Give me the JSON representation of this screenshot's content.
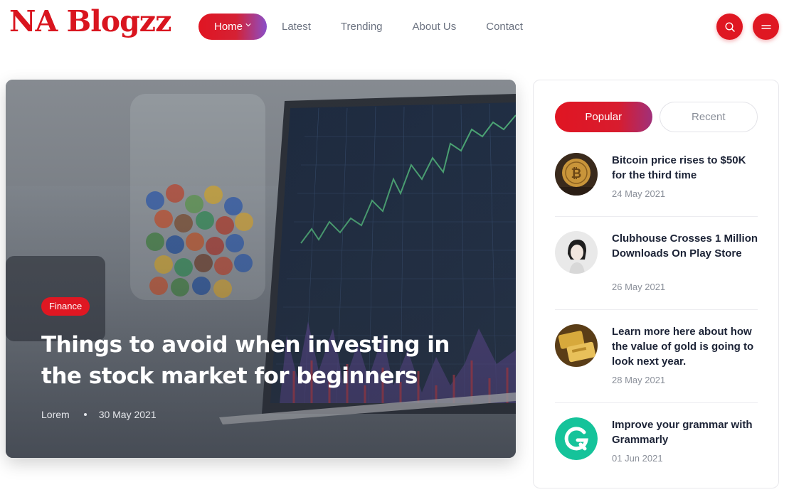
{
  "brand": {
    "logo_text": "NA Blogzz"
  },
  "nav": {
    "items": [
      {
        "label": "Home",
        "active": true
      },
      {
        "label": "Latest"
      },
      {
        "label": "Trending"
      },
      {
        "label": "About Us"
      },
      {
        "label": "Contact"
      }
    ]
  },
  "header_icons": {
    "search": "search-icon",
    "menu": "hamburger-menu-icon"
  },
  "hero": {
    "category": "Finance",
    "title": "Things to avoid when investing in the stock market for beginners",
    "author": "Lorem",
    "date": "30 May 2021"
  },
  "sidebar": {
    "tabs": [
      {
        "label": "Popular",
        "active": true
      },
      {
        "label": "Recent"
      }
    ],
    "posts": [
      {
        "title": "Bitcoin price rises to $50K for the third time",
        "date": "24 May 2021",
        "thumb": "bitcoin-coin-image"
      },
      {
        "title": "Clubhouse Crosses 1 Million Downloads On Play Store",
        "date": "26 May 2021",
        "thumb": "woman-portrait-image"
      },
      {
        "title": "Learn more here about how the value of gold is going to look next year.",
        "date": "28 May 2021",
        "thumb": "gold-bars-image"
      },
      {
        "title": "Improve your grammar with Grammarly",
        "date": "01 Jun 2021",
        "thumb": "grammarly-logo-image"
      }
    ]
  },
  "colors": {
    "accent": "#df1722",
    "accent_gradient_end": "#8a4fc9",
    "text_dark": "#1c2336",
    "text_muted": "#8a8f99"
  }
}
